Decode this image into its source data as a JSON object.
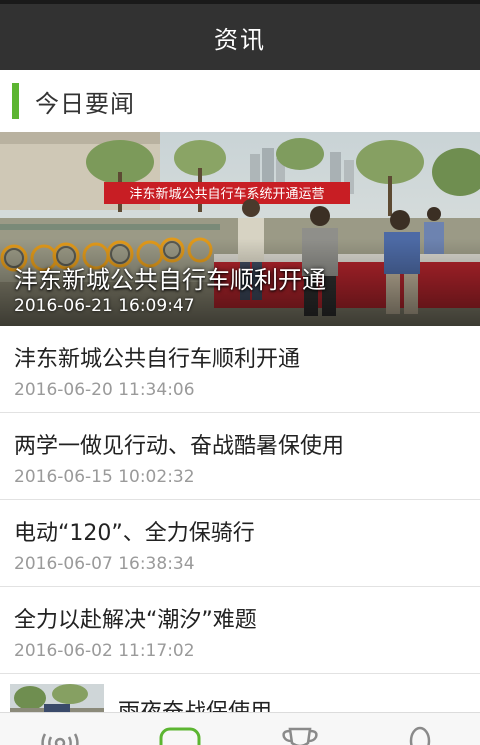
{
  "header": {
    "title": "资讯"
  },
  "section": {
    "title": "今日要闻",
    "accent_color": "#5cb531"
  },
  "featured": {
    "title": "沣东新城公共自行车顺利开通",
    "date": "2016-06-21 16:09:47",
    "banner_text": "沣东新城公共自行车系统开通运营",
    "image": "photo-bike-share-launch-event"
  },
  "news": [
    {
      "title": "沣东新城公共自行车顺利开通",
      "date": "2016-06-20 11:34:06"
    },
    {
      "title": "两学一做见行动、奋战酷暑保使用",
      "date": "2016-06-15 10:02:32"
    },
    {
      "title": "电动“120”、全力保骑行",
      "date": "2016-06-07 16:38:34"
    },
    {
      "title": "全力以赴解决“潮汐”难题",
      "date": "2016-06-02 11:17:02"
    }
  ],
  "thumb_news": {
    "title": "雨夜奋战保使用",
    "image": "photo-night-rain-work"
  },
  "tabs": [
    {
      "icon": "broadcast-icon"
    },
    {
      "icon": "chat-bubble-icon"
    },
    {
      "icon": "trophy-icon"
    },
    {
      "icon": "user-icon"
    }
  ],
  "colors": {
    "header_bg": "#323232",
    "active_tab": "#5cb531",
    "inactive_tab": "#8a8a8a"
  }
}
